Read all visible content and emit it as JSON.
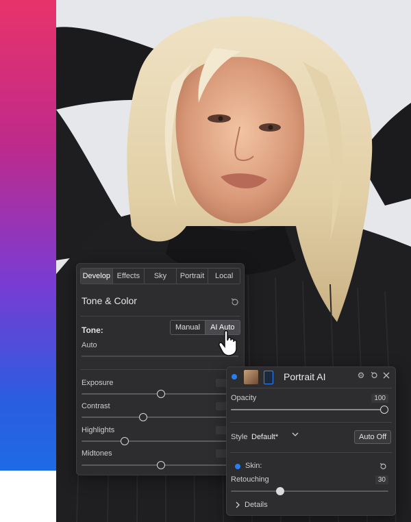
{
  "develop_panel": {
    "tabs": [
      "Develop",
      "Effects",
      "Sky",
      "Portrait",
      "Local"
    ],
    "active_tab": "Develop",
    "section_title": "Tone & Color",
    "tone_label": "Tone:",
    "tone_modes": [
      "Manual",
      "AI Auto"
    ],
    "active_mode": "AI Auto",
    "auto_label": "Auto",
    "sliders": [
      {
        "label": "Exposure",
        "value_fraction": 0.5
      },
      {
        "label": "Contrast",
        "value_fraction": 0.39
      },
      {
        "label": "Highlights",
        "value_fraction": 0.27
      },
      {
        "label": "Midtones",
        "value_fraction": 0.5
      }
    ]
  },
  "portrait_panel": {
    "title": "Portrait AI",
    "opacity_label": "Opacity",
    "opacity_value": "100",
    "style_label": "Style",
    "style_value": "Default*",
    "auto_off_label": "Auto Off",
    "skin_label": "Skin:",
    "retouching_label": "Retouching",
    "retouching_value": "30",
    "details_label": "Details"
  },
  "colors": {
    "panel_bg": "#2d2d2f",
    "accent_blue": "#2a7ff0",
    "gradient_top": "#e8336a",
    "gradient_bottom": "#1f6ae6"
  }
}
